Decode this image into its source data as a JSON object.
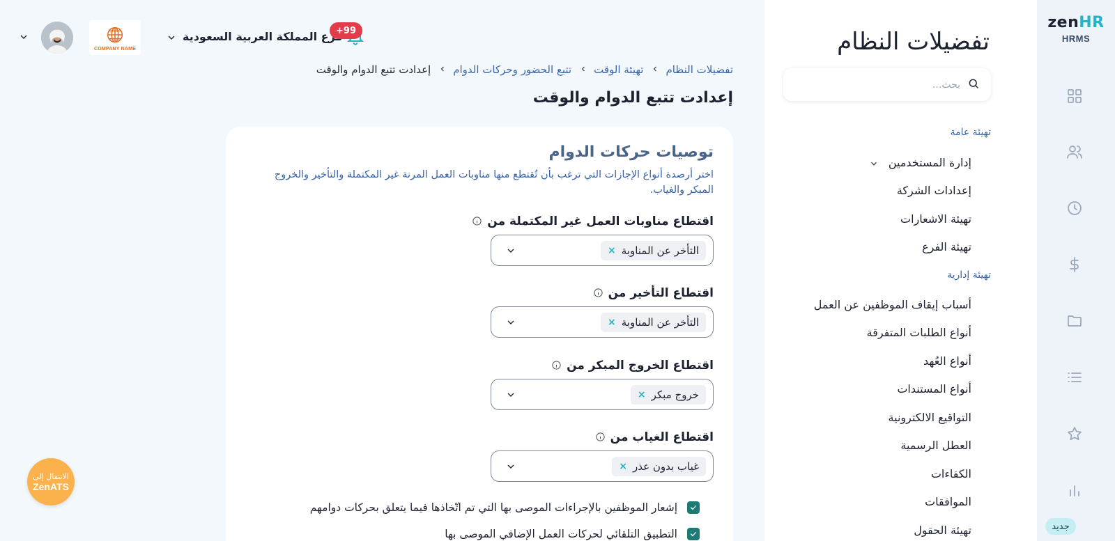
{
  "logo": {
    "brand_zen": "zen",
    "brand_hr": "HR",
    "product": "HRMS"
  },
  "rail": {
    "new_badge": "جديد"
  },
  "prefs": {
    "title": "تفضيلات النظام",
    "search_placeholder": "بحث...",
    "section_general": "تهيئة عامة",
    "section_admin": "تهيئة إدارية",
    "general_items": [
      {
        "label": "إدارة المستخدمين"
      },
      {
        "label": "إعدادات الشركة"
      },
      {
        "label": "تهيئة الاشعارات"
      },
      {
        "label": "تهيئة الفرع"
      }
    ],
    "admin_items": [
      {
        "label": "أسباب إيقاف الموظفين عن العمل"
      },
      {
        "label": "أنواع الطلبات المتفرقة"
      },
      {
        "label": "أنواع العُهد"
      },
      {
        "label": "أنواع المستندات"
      },
      {
        "label": "التواقيع الالكترونية"
      },
      {
        "label": "العطل الرسمية"
      },
      {
        "label": "الكفاءات"
      },
      {
        "label": "الموافقات"
      },
      {
        "label": "تهيئة الحقول"
      }
    ]
  },
  "topbar": {
    "branch": "فرع المملكة العربية السعودية",
    "notifications_count": "+99",
    "company_name": "COMPANY NAME"
  },
  "breadcrumb": [
    "تفضيلات النظام",
    "تهيئة الوقت",
    "تتبع الحضور وحركات الدوام",
    "إعدادت تتبع الدوام والوقت"
  ],
  "page_title": "إعدادت تتبع الدوام والوقت",
  "card": {
    "title": "توصيات حركات الدوام",
    "description": "اختر أرصدة أنواع الإجازات التي ترغب بأن تُقتطع منها مناوبات العمل المرنة غير المكتملة والتأخير والخروج المبكر والغياب.",
    "fields": [
      {
        "label": "اقتطاع مناوبات العمل غير المكتملة من",
        "chip": "التأخر عن المناوبة"
      },
      {
        "label": "اقتطاع التأخير من",
        "chip": "التأخر عن المناوبة"
      },
      {
        "label": "اقتطاع الخروج المبكر من",
        "chip": "خروج مبكر"
      },
      {
        "label": "اقتطاع الغياب من",
        "chip": "غياب بدون عذر"
      }
    ],
    "checkboxes": [
      {
        "label": "إشعار الموظفين بالإجراءات الموصى بها التي تم اتّخاذها فيما يتعلق بحركات دوامهم",
        "checked": true
      },
      {
        "label": "التطبيق التلقائي لحركات العمل الإضافي الموصى بها",
        "checked": true
      }
    ]
  },
  "zenats": {
    "line1": "الانتقال إلى",
    "line2": "ZenATS"
  },
  "colors": {
    "accent": "#22b3c4",
    "link": "#3a64a8",
    "checkbox": "#1e7a74",
    "badge": "#e23b4b",
    "zenats": "#fbb24d"
  }
}
